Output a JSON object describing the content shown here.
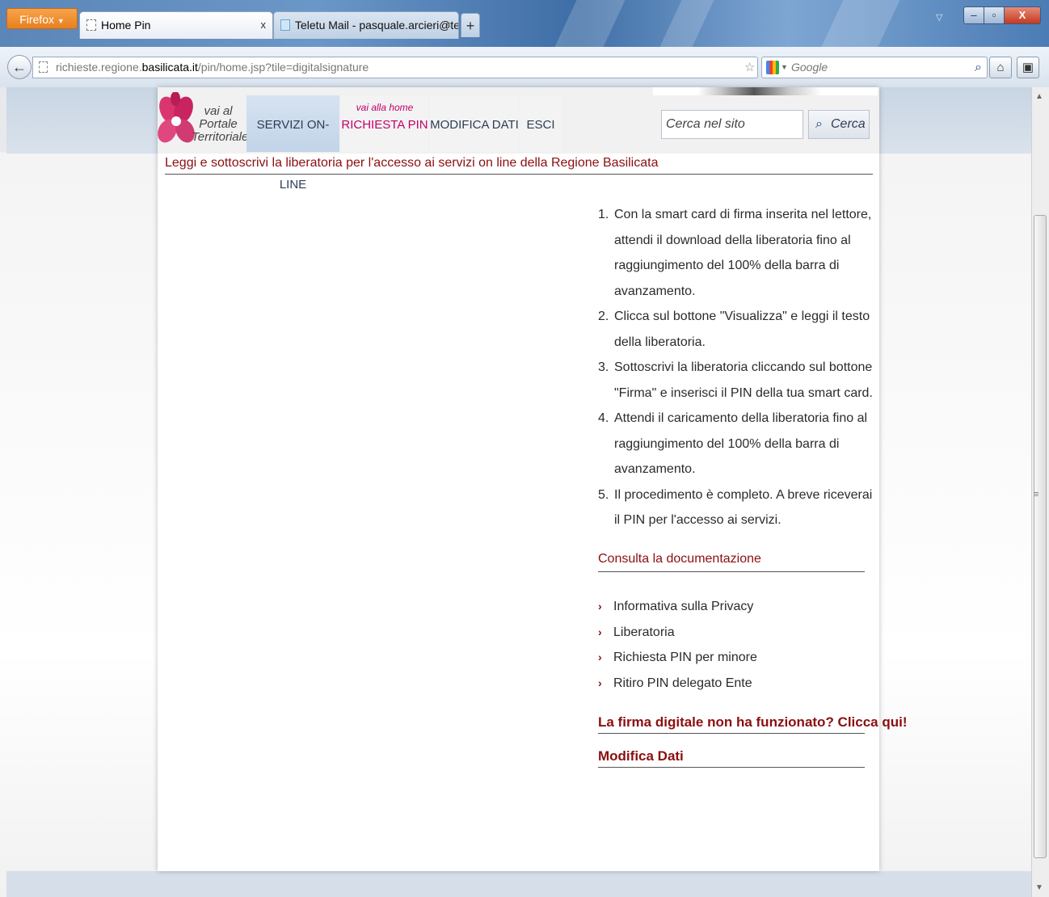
{
  "browser": {
    "app_button": "Firefox",
    "tabs": [
      {
        "title": "Home Pin",
        "close": "x",
        "active": true
      },
      {
        "title": "Teletu Mail - pasquale.arcieri@teletu....",
        "close": "×",
        "active": false
      }
    ],
    "new_tab": "+",
    "window_controls": {
      "minimize": "–",
      "maximize": "▫",
      "close": "X"
    },
    "url": {
      "prefix": "richieste.regione.",
      "host": "basilicata.it",
      "path": "/pin/home.jsp?tile=digitalsignature"
    },
    "url_actions": "☆ ▾ C",
    "search_placeholder": "Google",
    "accent": "#8b0f10"
  },
  "site": {
    "logo_text": [
      "vai al",
      "Portale",
      "Territoriale"
    ],
    "nav": {
      "servizi": "SERVIZI ON-LINE",
      "home_hint": "vai alla home",
      "richiesta": "RICHIESTA PIN",
      "modifica": "MODIFICA DATI",
      "esci": "ESCI"
    },
    "search": {
      "placeholder": "Cerca nel sito",
      "button": "Cerca"
    }
  },
  "main": {
    "heading": "Leggi e sottoscrivi la liberatoria per l'accesso ai servizi on line della Regione Basilicata",
    "steps": [
      {
        "num": "1.",
        "text": "Con la smart card di firma inserita nel lettore, attendi il download della liberatoria fino al raggiungimento del 100% della barra di avanzamento."
      },
      {
        "num": "2.",
        "text": "Clicca sul bottone \"Visualizza\" e leggi il testo della liberatoria."
      },
      {
        "num": "3.",
        "text": "Sottoscrivi la liberatoria cliccando sul bottone \"Firma\" e inserisci il PIN della tua smart card."
      },
      {
        "num": "4.",
        "text": "Attendi il caricamento della liberatoria fino al raggiungimento del 100% della barra di avanzamento."
      },
      {
        "num": "5.",
        "text": "Il procedimento è completo. A breve riceverai il PIN per l'accesso ai servizi."
      }
    ],
    "docs_title": "Consulta la documentazione",
    "docs": [
      {
        "label": "Informativa sulla Privacy"
      },
      {
        "label": "Liberatoria"
      },
      {
        "label": "Richiesta PIN per minore"
      },
      {
        "label": "Ritiro PIN delegato Ente"
      }
    ],
    "signature_help": "La firma digitale non ha funzionato? Clicca qui!",
    "modify_data": "Modifica Dati"
  }
}
